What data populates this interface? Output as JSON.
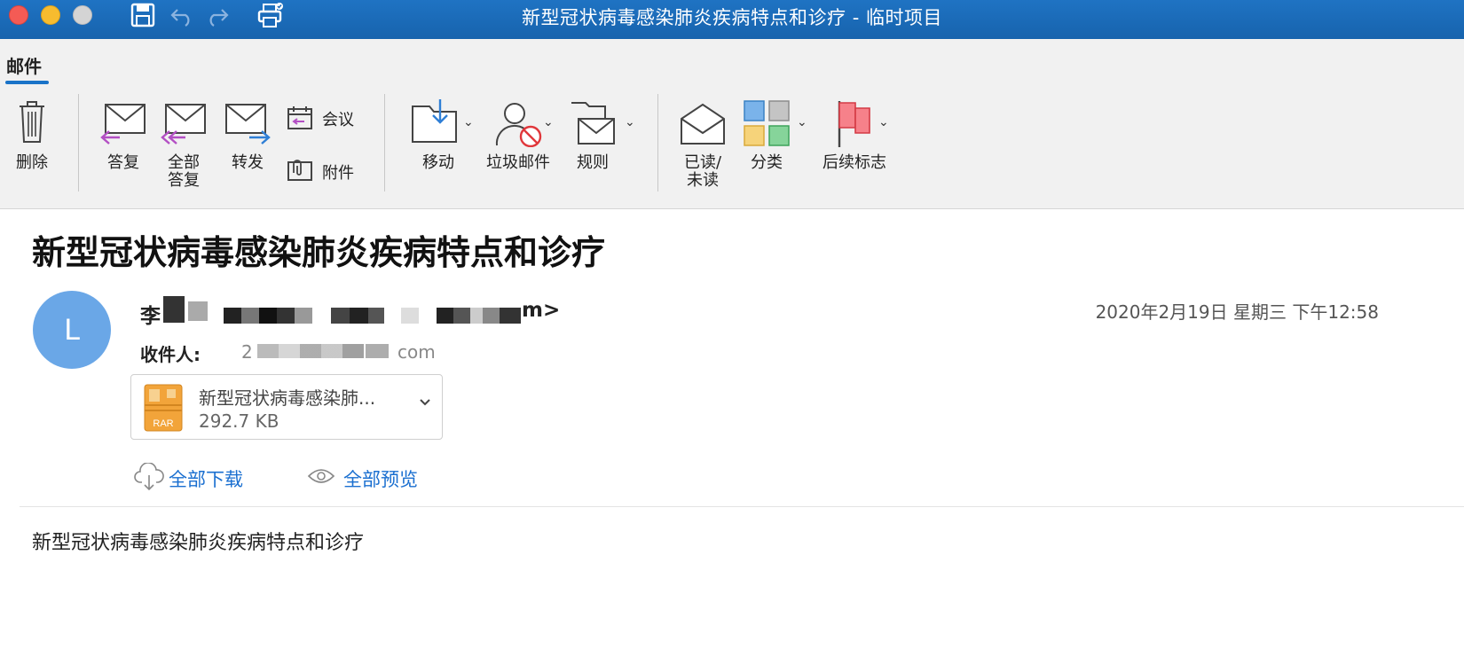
{
  "window": {
    "title": "新型冠状病毒感染肺炎疾病特点和诊疗 - 临时项目"
  },
  "titlebar_icons": [
    "save-icon",
    "undo-icon",
    "redo-icon",
    "print-icon"
  ],
  "ribbon": {
    "active_tab": "邮件",
    "buttons": {
      "delete": "删除",
      "reply": "答复",
      "reply_all_line1": "全部",
      "reply_all_line2": "答复",
      "forward": "转发",
      "meeting": "会议",
      "attachment": "附件",
      "move": "移动",
      "junk": "垃圾邮件",
      "rules": "规则",
      "read_unread_line1": "已读/",
      "read_unread_line2": "未读",
      "categorize": "分类",
      "follow_up": "后续标志"
    }
  },
  "message": {
    "subject": "新型冠状病毒感染肺炎疾病特点和诊疗",
    "avatar_initial": "L",
    "sender_prefix": "李",
    "sender_suffix": "m>",
    "date": "2020年2月19日 星期三 下午12:58",
    "to_label": "收件人:",
    "to_fragment_start": "2",
    "to_fragment_end": "com",
    "attachment": {
      "name": "新型冠状病毒感染肺...",
      "size": "292.7 KB",
      "type_label": "RAR"
    },
    "download_all": "全部下载",
    "preview_all": "全部预览",
    "body": "新型冠状病毒感染肺炎疾病特点和诊疗"
  },
  "colors": {
    "titlebar": "#1a6bb8",
    "avatar": "#6aa7e7",
    "link": "#1a6fd0",
    "accent_tab": "#1a73c8"
  }
}
